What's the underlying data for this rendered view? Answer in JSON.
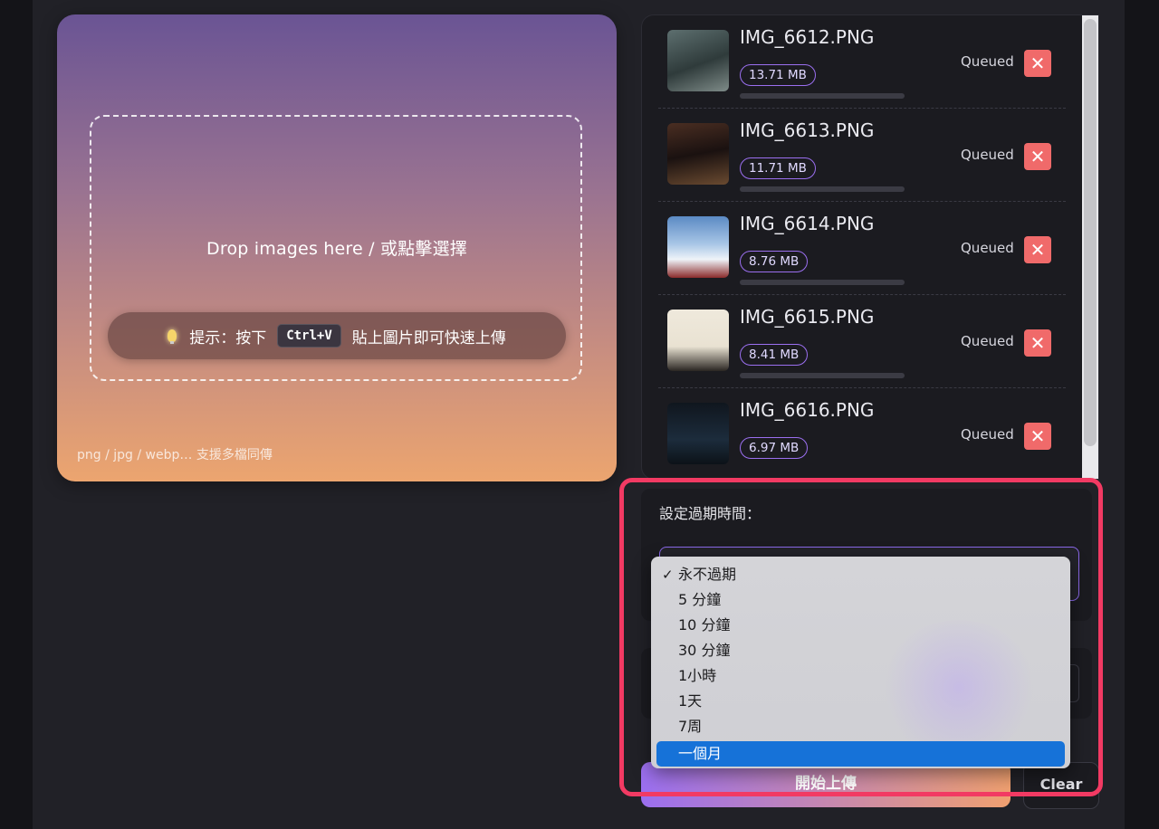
{
  "dropzone": {
    "main_text": "Drop images here / 或點擊選擇",
    "tip_prefix": "提示：按下",
    "tip_key": "Ctrl+V",
    "tip_suffix": "貼上圖片即可快速上傳",
    "formats": "png / jpg / webp… 支援多檔同傳"
  },
  "files": [
    {
      "name": "IMG_6612.PNG",
      "size": "13.71 MB",
      "status": "Queued"
    },
    {
      "name": "IMG_6613.PNG",
      "size": "11.71 MB",
      "status": "Queued"
    },
    {
      "name": "IMG_6614.PNG",
      "size": "8.76 MB",
      "status": "Queued"
    },
    {
      "name": "IMG_6615.PNG",
      "size": "8.41 MB",
      "status": "Queued"
    },
    {
      "name": "IMG_6616.PNG",
      "size": "6.97 MB",
      "status": "Queued"
    }
  ],
  "expiry": {
    "label": "設定過期時間：",
    "options": [
      "永不過期",
      "5 分鐘",
      "10 分鐘",
      "30 分鐘",
      "1小時",
      "1天",
      "7周",
      "一個月"
    ],
    "checked_index": 0,
    "highlighted_index": 7,
    "check_glyph": "✓"
  },
  "actions": {
    "upload_label": "開始上傳",
    "clear_label": "Clear"
  },
  "icons": {
    "remove": "close-icon",
    "tip": "lightbulb-icon",
    "select": "chevron-down-icon"
  },
  "colors": {
    "accent": "#9b6ff0",
    "danger": "#f06a6a",
    "annotation": "#f23a63",
    "menu_highlight": "#1672d8"
  }
}
